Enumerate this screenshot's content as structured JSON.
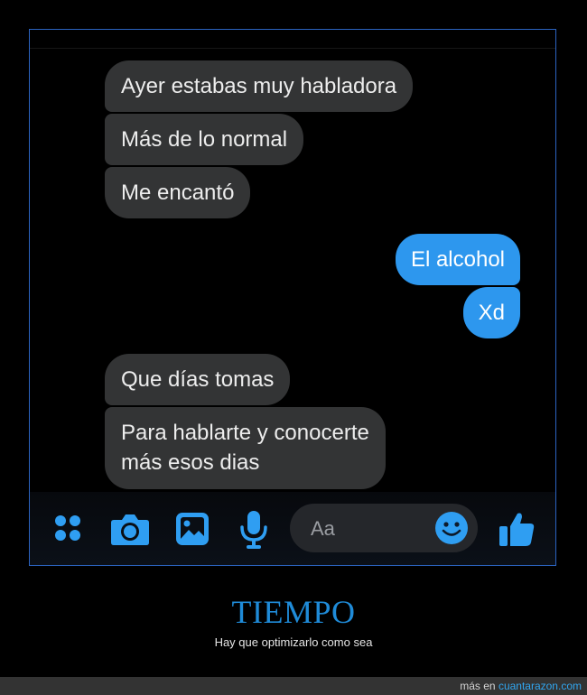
{
  "chat": {
    "messages": [
      {
        "direction": "incoming",
        "text": "Ayer estabas muy habladora"
      },
      {
        "direction": "incoming",
        "text": "Más de lo normal"
      },
      {
        "direction": "incoming",
        "text": "Me encantó"
      },
      {
        "direction": "outgoing",
        "text": "El alcohol"
      },
      {
        "direction": "outgoing",
        "text": "Xd"
      },
      {
        "direction": "incoming",
        "text": "Que días tomas"
      },
      {
        "direction": "incoming",
        "text_line1": "Para hablarte y conocerte",
        "text_line2": "más esos dias"
      }
    ]
  },
  "composer": {
    "placeholder": "Aa",
    "icons": [
      "apps-icon",
      "camera-icon",
      "gallery-icon",
      "microphone-icon",
      "emoji-icon",
      "thumbs-up-icon"
    ]
  },
  "post": {
    "title": "TIEMPO",
    "subtitle": "Hay que optimizarlo como sea"
  },
  "footer": {
    "prefix": "más en",
    "site": "cuantarazon.com"
  },
  "colors": {
    "incoming_bubble": "#333435",
    "outgoing_bubble": "#2d97ee",
    "accent": "#1f8bd8",
    "icon_blue": "#2f9ef2"
  }
}
